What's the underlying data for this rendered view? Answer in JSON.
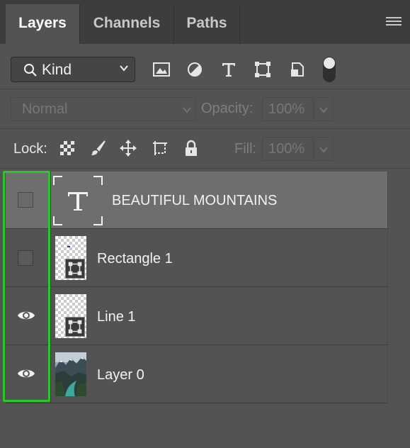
{
  "tabs": [
    {
      "label": "Layers",
      "active": true
    },
    {
      "label": "Channels",
      "active": false
    },
    {
      "label": "Paths",
      "active": false
    }
  ],
  "filter": {
    "kind_label": "Kind",
    "icons": [
      "image-filter-icon",
      "adjustment-filter-icon",
      "type-filter-icon",
      "shape-filter-icon",
      "smart-object-filter-icon"
    ]
  },
  "blend": {
    "mode": "Normal",
    "opacity_label": "Opacity:",
    "opacity_value": "100%"
  },
  "lock": {
    "label": "Lock:",
    "fill_label": "Fill:",
    "fill_value": "100%"
  },
  "layers": [
    {
      "name": "BEAUTIFUL MOUNTAINS",
      "type": "text",
      "visible": false,
      "selected": true
    },
    {
      "name": "Rectangle 1",
      "type": "shape",
      "visible": false,
      "selected": false
    },
    {
      "name": "Line 1",
      "type": "shape",
      "visible": true,
      "selected": false
    },
    {
      "name": "Layer 0",
      "type": "image",
      "visible": true,
      "selected": false
    }
  ],
  "colors": {
    "panel_bg": "#535353",
    "tabbar_bg": "#3d3d3d",
    "selected_row": "#6e6e6e",
    "highlight": "#2dc52d"
  }
}
